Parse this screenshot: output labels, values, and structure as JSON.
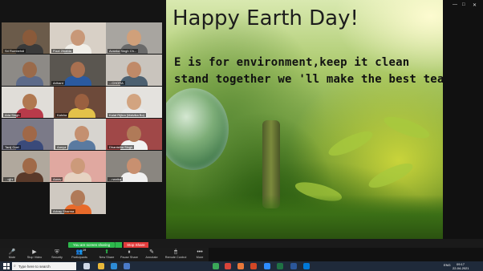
{
  "participants": [
    {
      "name": "Sri Rumbehdi",
      "bg": "#6b5b4a",
      "face": "#8a5a3a",
      "body": "#3a3a3a"
    },
    {
      "name": "Fiza! Zibahla",
      "bg": "#d8d0c6",
      "face": "#c89878",
      "body": "#f1efe9"
    },
    {
      "name": "Avanka Singh Ch...",
      "bg": "#a8a5a0",
      "face": "#d0a07a",
      "body": "#6a6a6a"
    },
    {
      "name": "",
      "bg": "#8d8a86",
      "face": "#9a6a4a",
      "body": "#5d6b8a"
    },
    {
      "name": "Arihant",
      "bg": "#5a5650",
      "face": "#a87050",
      "body": "#2a5aa0"
    },
    {
      "name": "...CHORA",
      "bg": "#c9c4bd",
      "face": "#c08a68",
      "body": "#4c6070"
    },
    {
      "name": "Aria Singh",
      "bg": "#e0ddd8",
      "face": "#b07850",
      "body": "#b83a4a"
    },
    {
      "name": "Kalsha",
      "bg": "#6d4a3a",
      "face": "#9a6040",
      "body": "#e3c24a"
    },
    {
      "name": "Kalat Rijhra (Malvika Bo)",
      "bg": "#e4e2de",
      "face": "#d2a480",
      "body": "#e8e8e8"
    },
    {
      "name": "Tanij Goel",
      "bg": "#7b7a88",
      "face": "#a06848",
      "body": "#3a4a7a"
    },
    {
      "name": "Aanya",
      "bg": "#d7d4cf",
      "face": "#c49070",
      "body": "#5a7aa0"
    },
    {
      "name": "Dhanistha Singh",
      "bg": "#a04848",
      "face": "#b07a58",
      "body": "#f2f2f2"
    },
    {
      "name": "...ojjhi",
      "bg": "#b0a89d",
      "face": "#a06a48",
      "body": "#5a3a2a"
    },
    {
      "name": "Aarav",
      "bg": "#e0a8a0",
      "face": "#cc9a7a",
      "body": "#e6d3c2"
    },
    {
      "name": "...nanika",
      "bg": "#8a8680",
      "face": "#c89070",
      "body": "#f0f0f0"
    },
    {
      "name": "Advay Sharma",
      "bg": "#cfc9c1",
      "face": "#b07a58",
      "body": "#e86a2a"
    }
  ],
  "slide": {
    "title": "Happy Earth Day!",
    "line1": "E is for environment,keep it clean",
    "line2": "stand together we 'll make the best team"
  },
  "window_controls": {
    "minimize": "—",
    "maximize": "□",
    "close": "✕"
  },
  "sharing_bar": {
    "status": "You are screen sharing",
    "stop": "Stop Share"
  },
  "toolbar": [
    {
      "key": "mute",
      "label": "Mute",
      "icon": "microphone-icon",
      "glyph": "🎤"
    },
    {
      "key": "video",
      "label": "Stop Video",
      "icon": "video-camera-icon",
      "glyph": "▶"
    },
    {
      "key": "security",
      "label": "Security",
      "icon": "shield-icon",
      "glyph": "⛨"
    },
    {
      "key": "participants",
      "label": "Participants",
      "icon": "participants-icon",
      "glyph": "👥",
      "count": "19"
    },
    {
      "key": "newshare",
      "label": "New Share",
      "icon": "share-screen-icon",
      "glyph": "⬆"
    },
    {
      "key": "pause",
      "label": "Pause Share",
      "icon": "pause-icon",
      "glyph": "⏸"
    },
    {
      "key": "annotate",
      "label": "Annotate",
      "icon": "pencil-icon",
      "glyph": "✎"
    },
    {
      "key": "remote",
      "label": "Remote Control",
      "icon": "cursor-icon",
      "glyph": "🖱"
    },
    {
      "key": "more",
      "label": "More",
      "icon": "more-icon",
      "glyph": "•••"
    }
  ],
  "taskbar": {
    "search_placeholder": "Type here to search",
    "apps": [
      {
        "name": "task-view-icon",
        "color": "#cfd8e6"
      },
      {
        "name": "file-explorer-icon",
        "color": "#e8b83a"
      },
      {
        "name": "edge-icon",
        "color": "#2d8bd6"
      },
      {
        "name": "mail-icon",
        "color": "#4a7ac8"
      },
      {
        "name": "chrome-icon",
        "color": "#3aa858"
      },
      {
        "name": "chrome-icon-2",
        "color": "#d8443a"
      },
      {
        "name": "firefox-icon",
        "color": "#e8783a"
      },
      {
        "name": "powerpoint-icon",
        "color": "#d24726"
      },
      {
        "name": "zoom-icon",
        "color": "#2d8cff"
      },
      {
        "name": "excel-icon",
        "color": "#1f7244"
      },
      {
        "name": "word-icon",
        "color": "#2b579a"
      },
      {
        "name": "store-icon",
        "color": "#0078d7"
      }
    ],
    "language": "ENG",
    "time": "09:17",
    "date": "22-04-2021"
  },
  "colors": {
    "share_green": "#2db84c",
    "stop_red": "#e23b3b"
  }
}
